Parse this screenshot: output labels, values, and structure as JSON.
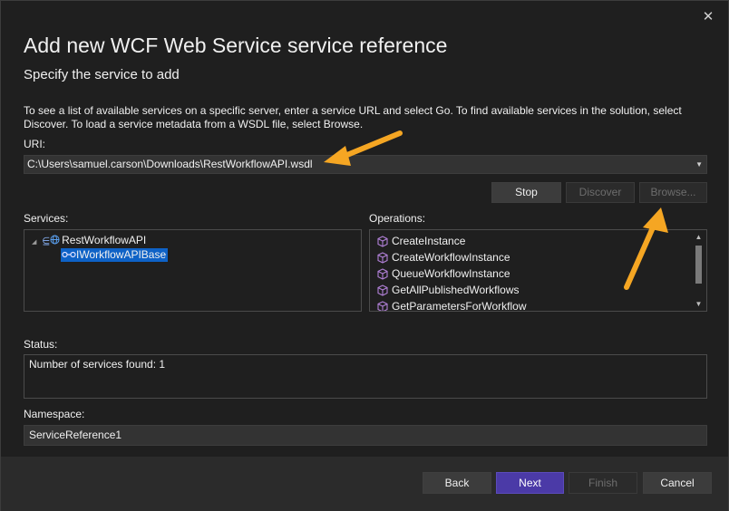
{
  "dialog": {
    "title": "Add new WCF Web Service service reference",
    "subtitle": "Specify the service to add",
    "description": "To see a list of available services on a specific server, enter a service URL and select Go. To find available services in the solution, select Discover. To load a service metadata from a WSDL file, select Browse.",
    "close_icon": "close-icon"
  },
  "uri": {
    "label": "URI:",
    "value": "C:\\Users\\samuel.carson\\Downloads\\RestWorkflowAPI.wsdl"
  },
  "actions": {
    "stop": "Stop",
    "discover": "Discover",
    "browse": "Browse..."
  },
  "services": {
    "label": "Services:",
    "root": "RestWorkflowAPI",
    "child": "IWorkflowAPIBase"
  },
  "operations": {
    "label": "Operations:",
    "items": [
      "CreateInstance",
      "CreateWorkflowInstance",
      "QueueWorkflowInstance",
      "GetAllPublishedWorkflows",
      "GetParametersForWorkflow"
    ]
  },
  "status": {
    "label": "Status:",
    "text": "Number of services found: 1"
  },
  "namespace": {
    "label": "Namespace:",
    "value": "ServiceReference1"
  },
  "footer": {
    "back": "Back",
    "next": "Next",
    "finish": "Finish",
    "cancel": "Cancel"
  },
  "colors": {
    "accent": "#4b3aa7",
    "selection": "#0e62c6",
    "arrow": "#f5a623",
    "operation_icon": "#b180d7"
  }
}
